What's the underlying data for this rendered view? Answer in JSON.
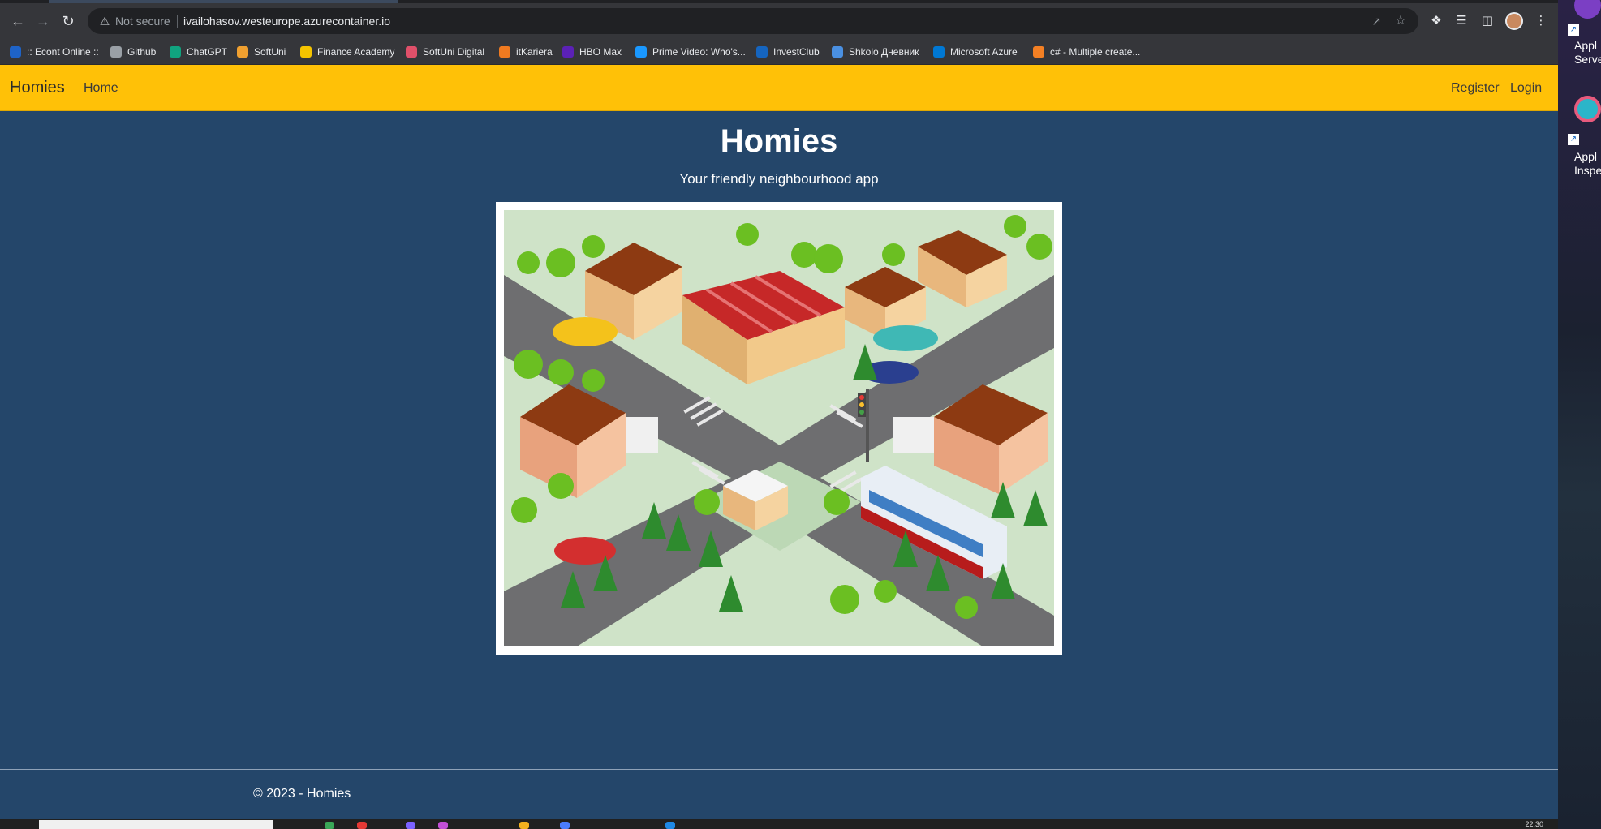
{
  "browser": {
    "url_warning": "Not secure",
    "url": "ivailohasov.westeurope.azurecontainer.io",
    "bookmarks": [
      {
        "label": ":: Econt Online ::",
        "color": "#1e63c7"
      },
      {
        "label": "Github",
        "color": "#9aa0a6"
      },
      {
        "label": "ChatGPT",
        "color": "#10a37f"
      },
      {
        "label": "SoftUni",
        "color": "#f0a030"
      },
      {
        "label": "Finance Academy",
        "color": "#f5c400"
      },
      {
        "label": "SoftUni Digital",
        "color": "#e0506a"
      },
      {
        "label": "itKariera",
        "color": "#f07a20"
      },
      {
        "label": "HBO Max",
        "color": "#5b21b6"
      },
      {
        "label": "Prime Video: Who's...",
        "color": "#1a98ff"
      },
      {
        "label": "InvestClub",
        "color": "#1565c0"
      },
      {
        "label": "Shkolo Дневник",
        "color": "#4a90e2"
      },
      {
        "label": "Microsoft Azure",
        "color": "#0078d4"
      },
      {
        "label": "c# - Multiple create...",
        "color": "#f48024"
      }
    ]
  },
  "navbar": {
    "brand": "Homies",
    "links": {
      "home": "Home",
      "register": "Register",
      "login": "Login"
    },
    "color": "#ffc107"
  },
  "hero": {
    "title": "Homies",
    "subtitle": "Your friendly neighbourhood app",
    "image_alt": "Isometric neighbourhood illustration"
  },
  "footer": {
    "text": "© 2023 - Homies"
  },
  "desktop": {
    "shortcuts": [
      {
        "label_line1": "Appl",
        "label_line2": "Serve"
      },
      {
        "label_line1": "Appl",
        "label_line2": "Inspe"
      }
    ]
  },
  "taskbar": {
    "clock": "22:30"
  },
  "colors": {
    "page_bg": "#24466a",
    "accent": "#ffc107",
    "text": "#ffffff"
  }
}
